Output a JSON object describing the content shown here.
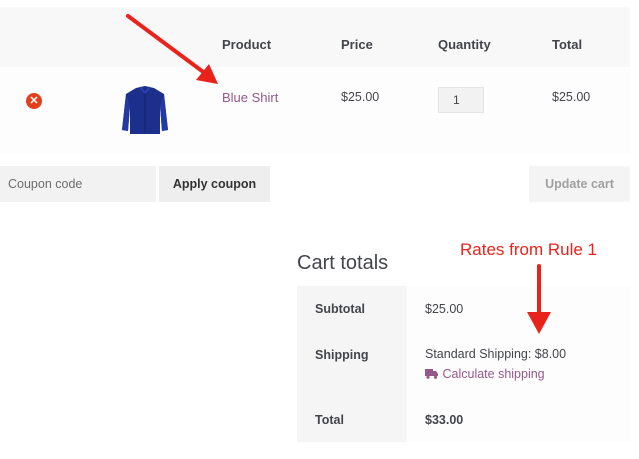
{
  "cart_table": {
    "headers": {
      "product": "Product",
      "price": "Price",
      "quantity": "Quantity",
      "total": "Total"
    },
    "row": {
      "product_name": "Blue Shirt",
      "price": "$25.00",
      "quantity": "1",
      "total": "$25.00"
    }
  },
  "actions": {
    "coupon_placeholder": "Coupon code",
    "apply_coupon_label": "Apply coupon",
    "update_cart_label": "Update cart"
  },
  "cart_totals": {
    "title": "Cart totals",
    "subtotal_label": "Subtotal",
    "subtotal_value": "$25.00",
    "shipping_label": "Shipping",
    "shipping_value": "Standard Shipping: $8.00",
    "calculate_shipping": "Calculate shipping",
    "total_label": "Total",
    "total_value": "$33.00"
  },
  "annotation": {
    "text": "Rates from Rule 1",
    "color": "#e8231c"
  },
  "colors": {
    "accent": "#96588a",
    "remove": "#e2401c"
  },
  "icons": {
    "remove": "remove-circle-icon",
    "shirt": "blue-shirt-thumbnail",
    "truck": "truck-icon"
  }
}
